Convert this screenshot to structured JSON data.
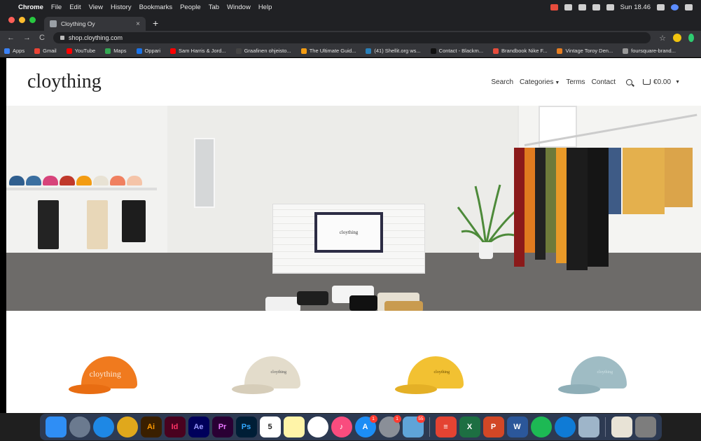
{
  "menubar": {
    "app": "Chrome",
    "items": [
      "File",
      "Edit",
      "View",
      "History",
      "Bookmarks",
      "People",
      "Tab",
      "Window",
      "Help"
    ],
    "clock": "Sun 18.46"
  },
  "tab": {
    "title": "Cloything Oy",
    "close": "×",
    "new": "+"
  },
  "address": {
    "url": "shop.cloything.com",
    "back": "←",
    "forward": "→",
    "reload": "C",
    "star": "☆",
    "menu": "⋮"
  },
  "bookmarks": [
    {
      "label": "Apps",
      "color": "#3b82f6"
    },
    {
      "label": "Gmail",
      "color": "#ea4335"
    },
    {
      "label": "YouTube",
      "color": "#ff0000"
    },
    {
      "label": "Maps",
      "color": "#34a853"
    },
    {
      "label": "Oppari",
      "color": "#1a73e8"
    },
    {
      "label": "Sam Harris & Jord...",
      "color": "#ff0000"
    },
    {
      "label": "Graafinen ohjeisto...",
      "color": "#444"
    },
    {
      "label": "The Ultimate Guid...",
      "color": "#f39c12"
    },
    {
      "label": "(41) Shellit.org ws...",
      "color": "#2980b9"
    },
    {
      "label": "Contact - Blackm...",
      "color": "#111"
    },
    {
      "label": "Brandbook Nike F...",
      "color": "#e74c3c"
    },
    {
      "label": "Vintage Toroy Den...",
      "color": "#e67e22"
    },
    {
      "label": "foursquare-brand...",
      "color": "#999"
    }
  ],
  "site": {
    "logo": "cloything",
    "nav": {
      "search": "Search",
      "categories": "Categories",
      "terms": "Terms",
      "contact": "Contact",
      "cart_total": "€0.00"
    },
    "tv_text": "cloything",
    "products": [
      {
        "color": "#f07a1e",
        "brim": "#e86d12",
        "label": "cloything",
        "label_color": "#fbe7d6"
      },
      {
        "color": "#e3dccb",
        "brim": "#d6cdb9",
        "label": "cloything",
        "label_color": "#555"
      },
      {
        "color": "#f2c132",
        "brim": "#e4b026",
        "label": "cloything",
        "label_color": "#6b4d00"
      },
      {
        "color": "#9fbcc4",
        "brim": "#8eaeb7",
        "label": "cloything",
        "label_color": "#cfe2e6"
      }
    ]
  },
  "dock": [
    {
      "name": "finder-icon",
      "bg": "#2f8ef5",
      "text": "",
      "round": false
    },
    {
      "name": "launchpad-icon",
      "bg": "#6b7a8f",
      "text": "",
      "round": true
    },
    {
      "name": "safari-icon",
      "bg": "#1e88e5",
      "text": "",
      "round": true
    },
    {
      "name": "chrome-icon",
      "bg": "#e0a81c",
      "text": "",
      "round": true
    },
    {
      "name": "illustrator-icon",
      "bg": "#3a1f00",
      "text": "Ai",
      "color": "#ff9a00"
    },
    {
      "name": "indesign-icon",
      "bg": "#49021f",
      "text": "Id",
      "color": "#ff3366"
    },
    {
      "name": "after-effects-icon",
      "bg": "#00005b",
      "text": "Ae",
      "color": "#9999ff"
    },
    {
      "name": "premiere-icon",
      "bg": "#2a0034",
      "text": "Pr",
      "color": "#ea77ff"
    },
    {
      "name": "photoshop-icon",
      "bg": "#001e36",
      "text": "Ps",
      "color": "#31a8ff"
    },
    {
      "name": "calendar-icon",
      "bg": "#ffffff",
      "text": "5",
      "color": "#222"
    },
    {
      "name": "notes-icon",
      "bg": "#fff4a8",
      "text": "",
      "round": false
    },
    {
      "name": "photos-icon",
      "bg": "#ffffff",
      "text": "",
      "round": true
    },
    {
      "name": "itunes-icon",
      "bg": "#f94c7e",
      "text": "♪",
      "round": true
    },
    {
      "name": "app-store-icon",
      "bg": "#1c8df5",
      "text": "A",
      "round": true,
      "badge": "1"
    },
    {
      "name": "system-preferences-icon",
      "bg": "#8a8f98",
      "text": "",
      "round": true,
      "badge": "1"
    },
    {
      "name": "preview-icon",
      "bg": "#5fa4d8",
      "text": "",
      "badge": "55"
    },
    {
      "sep": true
    },
    {
      "name": "todoist-icon",
      "bg": "#e44332",
      "text": "≡"
    },
    {
      "name": "excel-icon",
      "bg": "#1d6f42",
      "text": "X"
    },
    {
      "name": "powerpoint-icon",
      "bg": "#d24726",
      "text": "P"
    },
    {
      "name": "word-icon",
      "bg": "#2b579a",
      "text": "W"
    },
    {
      "name": "spotify-icon",
      "bg": "#1db954",
      "text": "",
      "round": true
    },
    {
      "name": "edge-icon",
      "bg": "#0f7bd6",
      "text": "",
      "round": true
    },
    {
      "name": "image-capture-icon",
      "bg": "#9eb5c9",
      "text": ""
    },
    {
      "sep": true
    },
    {
      "name": "documents-folder-icon",
      "bg": "#e8e3d6",
      "text": ""
    },
    {
      "name": "trash-icon",
      "bg": "#7d7d7d",
      "text": ""
    }
  ]
}
